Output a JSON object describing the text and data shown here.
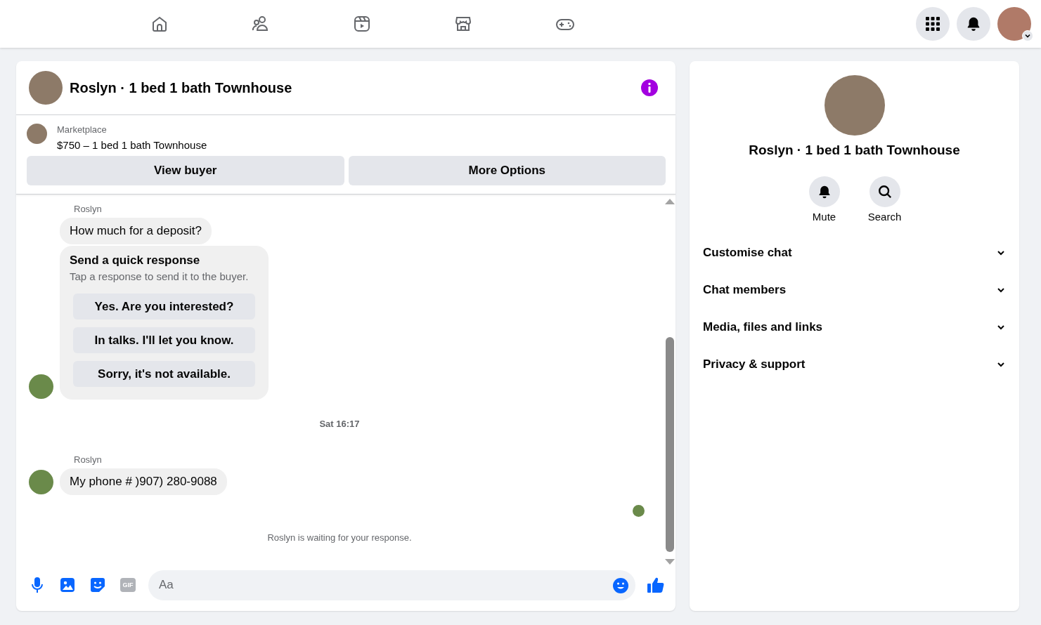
{
  "conversation": {
    "title": "Roslyn · 1 bed 1 bath Townhouse",
    "listing": {
      "source": "Marketplace",
      "price_title": "$750 – 1 bed 1 bath Townhouse"
    },
    "actions": [
      "View buyer",
      "More Options"
    ]
  },
  "messages": [
    {
      "kind": "group",
      "sender": "Roslyn",
      "items": [
        {
          "kind": "text",
          "text": "How much for a deposit?"
        },
        {
          "kind": "quick",
          "title": "Send a quick response",
          "hint": "Tap a response to send it to the buyer.",
          "options": [
            "Yes. Are you interested?",
            "In talks. I'll let you know.",
            "Sorry, it's not available."
          ]
        }
      ]
    },
    {
      "kind": "time",
      "text": "Sat 16:17"
    },
    {
      "kind": "group",
      "sender": "Roslyn",
      "items": [
        {
          "kind": "text",
          "text": "My phone # )907) 280-9088"
        }
      ]
    },
    {
      "kind": "seen"
    },
    {
      "kind": "status",
      "text": "Roslyn is waiting for your response."
    }
  ],
  "composer": {
    "placeholder": "Aa",
    "gif": "GIF"
  },
  "details": {
    "title": "Roslyn · 1 bed 1 bath Townhouse",
    "buttons": [
      {
        "kind": "bell",
        "label": "Mute"
      },
      {
        "kind": "search",
        "label": "Search"
      }
    ],
    "sections": [
      {
        "label": "Customise chat",
        "expanded": false
      },
      {
        "label": "Chat members",
        "expanded": false
      },
      {
        "label": "Media, files and links",
        "expanded": false
      },
      {
        "label": "Privacy & support",
        "expanded": false
      }
    ]
  }
}
